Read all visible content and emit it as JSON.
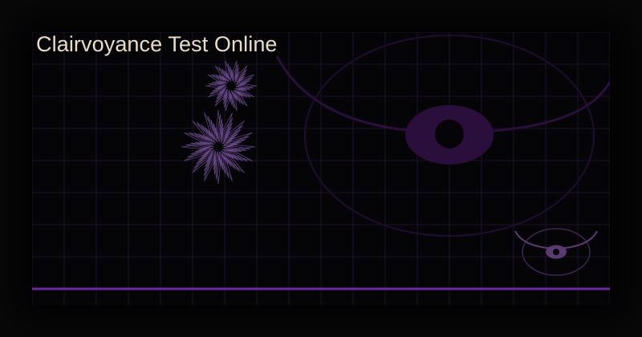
{
  "title": "Clairvoyance Test Online",
  "colors": {
    "background": "#080808",
    "panel": "#050508",
    "grid": "#1c0e2a",
    "accent": "#6a2a9a",
    "eye_dark": "#2a0e3c",
    "eye_outline": "#200c30",
    "small_eye": "#5a3a70",
    "starburst": "#6a4a8a",
    "title_text": "#e8dcc8"
  },
  "icons": {
    "large_eye": "eye-icon",
    "small_eye": "eye-icon",
    "starbursts": "starburst-icon"
  }
}
